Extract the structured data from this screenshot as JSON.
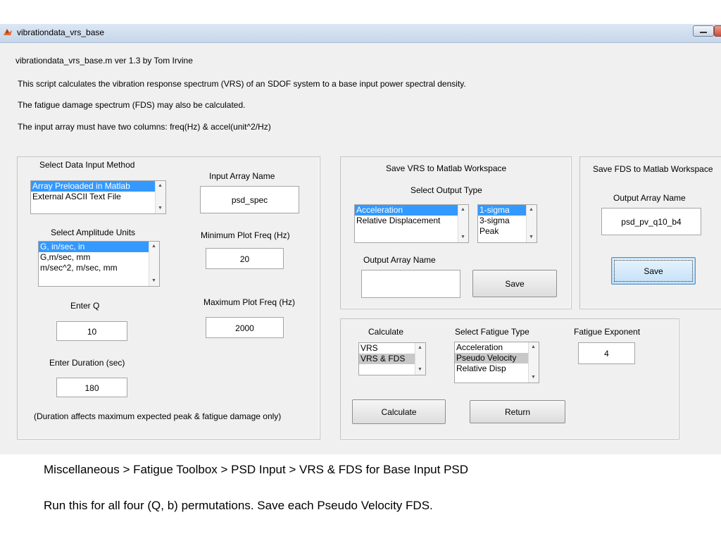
{
  "window": {
    "title": "vibrationdata_vrs_base"
  },
  "header": {
    "version_line": "vibrationdata_vrs_base.m   ver 1.3   by Tom Irvine",
    "desc1": "This script calculates the vibration response spectrum (VRS) of an SDOF system to a base input power spectral density.",
    "desc2": "The fatigue damage spectrum (FDS) may also be calculated.",
    "desc3": "The input array must have two columns: freq(Hz) & accel(unit^2/Hz)"
  },
  "input_panel": {
    "method_label": "Select Data Input Method",
    "method_options": [
      "Array Preloaded in Matlab",
      "External ASCII Text File"
    ],
    "array_name_label": "Input Array Name",
    "array_name_value": "psd_spec",
    "units_label": "Select Amplitude Units",
    "units_options": [
      "G, in/sec, in",
      "G,m/sec, mm",
      "m/sec^2, m/sec, mm"
    ],
    "min_freq_label": "Minimum Plot Freq (Hz)",
    "min_freq_value": "20",
    "q_label": "Enter Q",
    "q_value": "10",
    "max_freq_label": "Maximum Plot Freq (Hz)",
    "max_freq_value": "2000",
    "duration_label": "Enter Duration (sec)",
    "duration_value": "180",
    "duration_note": "(Duration affects maximum expected peak & fatigue damage only)"
  },
  "vrs_panel": {
    "title": "Save VRS to Matlab Workspace",
    "output_type_label": "Select Output Type",
    "output_type_options": [
      "Acceleration",
      "Relative Displacement"
    ],
    "sigma_options": [
      "1-sigma",
      "3-sigma",
      "Peak"
    ],
    "output_name_label": "Output Array Name",
    "output_name_value": "",
    "save_label": "Save"
  },
  "fds_panel": {
    "title": "Save FDS to Matlab Workspace",
    "output_name_label": "Output Array Name",
    "output_name_value": "psd_pv_q10_b4",
    "save_label": "Save"
  },
  "calc_panel": {
    "calculate_label": "Calculate",
    "calc_options": [
      "VRS",
      "VRS & FDS"
    ],
    "fatigue_type_label": "Select Fatigue Type",
    "fatigue_type_options": [
      "Acceleration",
      "Pseudo Velocity",
      "Relative Disp"
    ],
    "exponent_label": "Fatigue Exponent",
    "exponent_value": "4",
    "calculate_button": "Calculate",
    "return_button": "Return"
  },
  "notes": {
    "path": "Miscellaneous > Fatigue Toolbox > PSD Input >  VRS & FDS for Base Input PSD",
    "instruction": "Run this for all four (Q, b) permutations.  Save each Pseudo Velocity FDS."
  },
  "colors": {
    "selection": "#3399ff",
    "window_bg": "#f0f0f0"
  }
}
